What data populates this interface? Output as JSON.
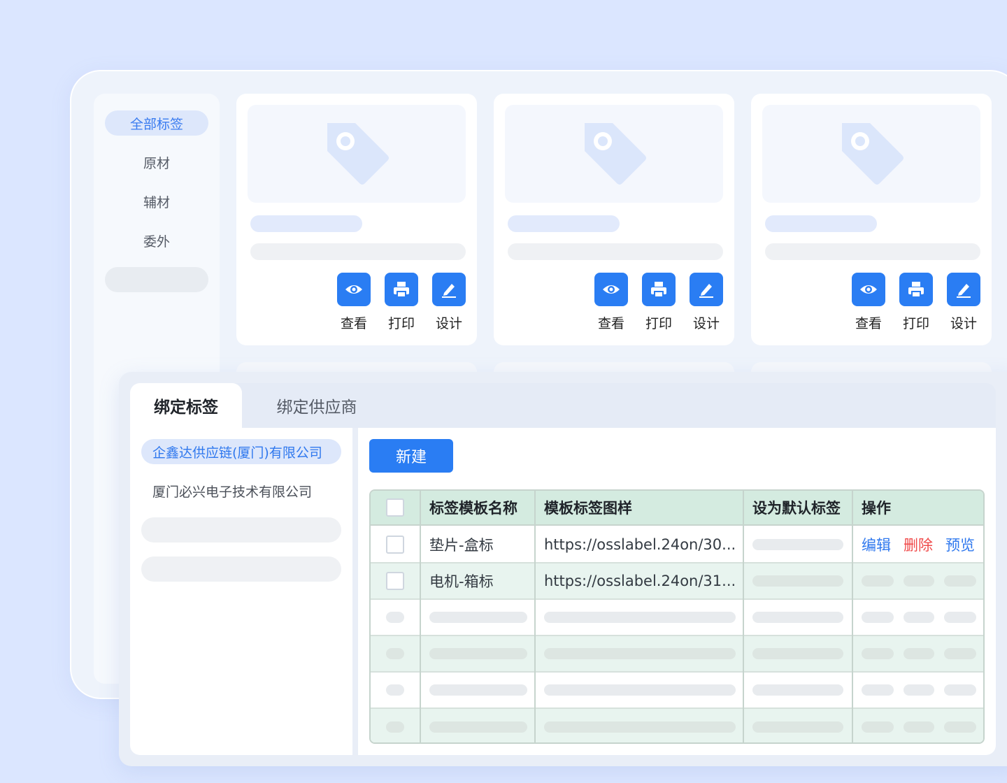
{
  "categories": {
    "items": [
      "全部标签",
      "原材",
      "辅材",
      "委外"
    ],
    "active": "全部标签"
  },
  "cards": [
    {
      "actions": [
        "查看",
        "打印",
        "设计"
      ]
    },
    {
      "actions": [
        "查看",
        "打印",
        "设计"
      ]
    },
    {
      "actions": [
        "查看",
        "打印",
        "设计"
      ]
    }
  ],
  "tabs": {
    "bind_label": "绑定标签",
    "bind_supplier": "绑定供应商"
  },
  "suppliers": [
    "企鑫达供应链(厦门)有限公司",
    "厦门必兴电子技术有限公司"
  ],
  "toolbar": {
    "new_label": "新建"
  },
  "table": {
    "headers": [
      "标签模板名称",
      "模板标签图样",
      "设为默认标签",
      "操作"
    ],
    "rows": [
      {
        "name": "垫片-盒标",
        "url": "https://osslabel.24on/30..."
      },
      {
        "name": "电机-箱标",
        "url": "https://osslabel.24on/31..."
      }
    ],
    "row_actions": [
      "编辑",
      "删除",
      "预览"
    ]
  },
  "colors": {
    "accent": "#2a7df3",
    "danger": "#f04a4a",
    "table_header": "#d4ebe0"
  }
}
